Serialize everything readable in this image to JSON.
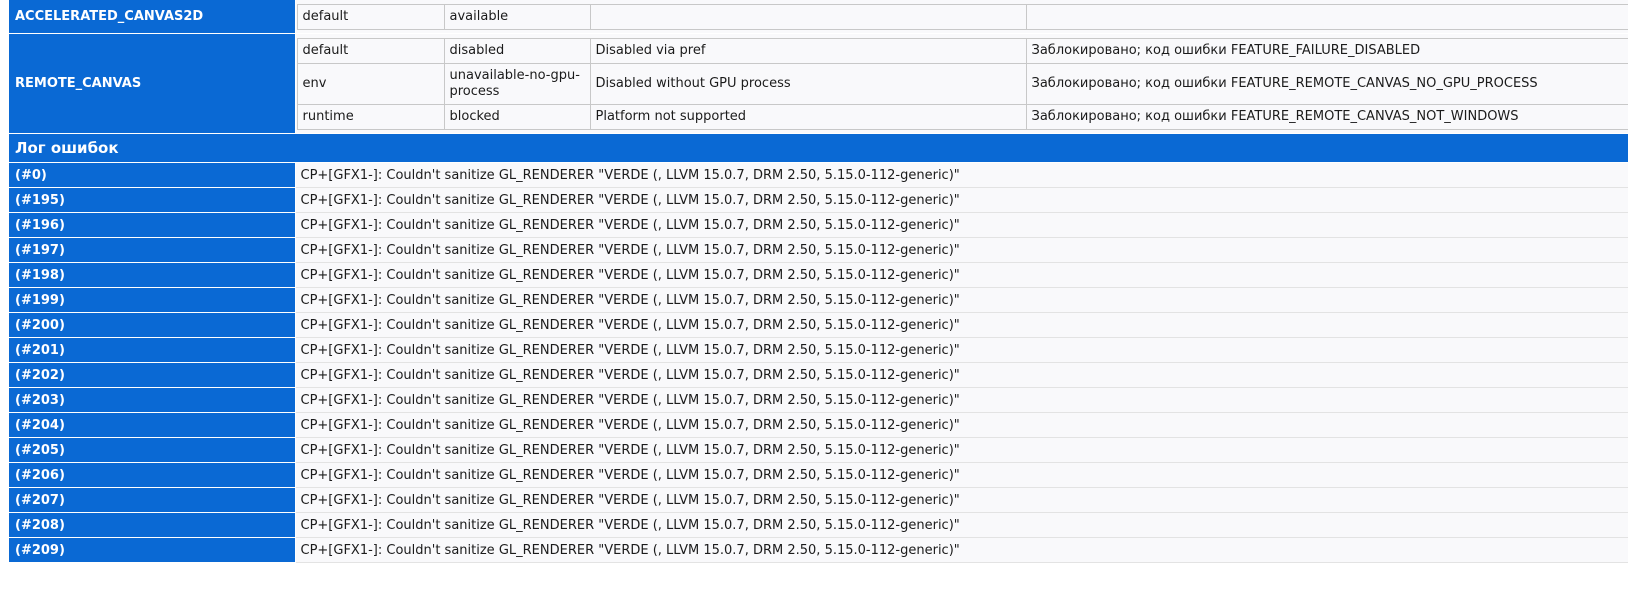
{
  "features": [
    {
      "name": "ACCELERATED_CANVAS2D",
      "rows": [
        {
          "type": "default",
          "status": "available",
          "message": "",
          "localized": ""
        }
      ]
    },
    {
      "name": "REMOTE_CANVAS",
      "rows": [
        {
          "type": "default",
          "status": "disabled",
          "message": "Disabled via pref",
          "localized": "Заблокировано; код ошибки FEATURE_FAILURE_DISABLED"
        },
        {
          "type": "env",
          "status": "unavailable-no-gpu-process",
          "message": "Disabled without GPU process",
          "localized": "Заблокировано; код ошибки FEATURE_REMOTE_CANVAS_NO_GPU_PROCESS"
        },
        {
          "type": "runtime",
          "status": "blocked",
          "message": "Platform not supported",
          "localized": "Заблокировано; код ошибки FEATURE_REMOTE_CANVAS_NOT_WINDOWS"
        }
      ]
    }
  ],
  "error_log": {
    "title": "Лог ошибок",
    "entries": [
      {
        "id": "(#0)",
        "message": "CP+[GFX1-]: Couldn't sanitize GL_RENDERER \"VERDE (, LLVM 15.0.7, DRM 2.50, 5.15.0-112-generic)\""
      },
      {
        "id": "(#195)",
        "message": "CP+[GFX1-]: Couldn't sanitize GL_RENDERER \"VERDE (, LLVM 15.0.7, DRM 2.50, 5.15.0-112-generic)\""
      },
      {
        "id": "(#196)",
        "message": "CP+[GFX1-]: Couldn't sanitize GL_RENDERER \"VERDE (, LLVM 15.0.7, DRM 2.50, 5.15.0-112-generic)\""
      },
      {
        "id": "(#197)",
        "message": "CP+[GFX1-]: Couldn't sanitize GL_RENDERER \"VERDE (, LLVM 15.0.7, DRM 2.50, 5.15.0-112-generic)\""
      },
      {
        "id": "(#198)",
        "message": "CP+[GFX1-]: Couldn't sanitize GL_RENDERER \"VERDE (, LLVM 15.0.7, DRM 2.50, 5.15.0-112-generic)\""
      },
      {
        "id": "(#199)",
        "message": "CP+[GFX1-]: Couldn't sanitize GL_RENDERER \"VERDE (, LLVM 15.0.7, DRM 2.50, 5.15.0-112-generic)\""
      },
      {
        "id": "(#200)",
        "message": "CP+[GFX1-]: Couldn't sanitize GL_RENDERER \"VERDE (, LLVM 15.0.7, DRM 2.50, 5.15.0-112-generic)\""
      },
      {
        "id": "(#201)",
        "message": "CP+[GFX1-]: Couldn't sanitize GL_RENDERER \"VERDE (, LLVM 15.0.7, DRM 2.50, 5.15.0-112-generic)\""
      },
      {
        "id": "(#202)",
        "message": "CP+[GFX1-]: Couldn't sanitize GL_RENDERER \"VERDE (, LLVM 15.0.7, DRM 2.50, 5.15.0-112-generic)\""
      },
      {
        "id": "(#203)",
        "message": "CP+[GFX1-]: Couldn't sanitize GL_RENDERER \"VERDE (, LLVM 15.0.7, DRM 2.50, 5.15.0-112-generic)\""
      },
      {
        "id": "(#204)",
        "message": "CP+[GFX1-]: Couldn't sanitize GL_RENDERER \"VERDE (, LLVM 15.0.7, DRM 2.50, 5.15.0-112-generic)\""
      },
      {
        "id": "(#205)",
        "message": "CP+[GFX1-]: Couldn't sanitize GL_RENDERER \"VERDE (, LLVM 15.0.7, DRM 2.50, 5.15.0-112-generic)\""
      },
      {
        "id": "(#206)",
        "message": "CP+[GFX1-]: Couldn't sanitize GL_RENDERER \"VERDE (, LLVM 15.0.7, DRM 2.50, 5.15.0-112-generic)\""
      },
      {
        "id": "(#207)",
        "message": "CP+[GFX1-]: Couldn't sanitize GL_RENDERER \"VERDE (, LLVM 15.0.7, DRM 2.50, 5.15.0-112-generic)\""
      },
      {
        "id": "(#208)",
        "message": "CP+[GFX1-]: Couldn't sanitize GL_RENDERER \"VERDE (, LLVM 15.0.7, DRM 2.50, 5.15.0-112-generic)\""
      },
      {
        "id": "(#209)",
        "message": "CP+[GFX1-]: Couldn't sanitize GL_RENDERER \"VERDE (, LLVM 15.0.7, DRM 2.50, 5.15.0-112-generic)\""
      }
    ]
  },
  "colors": {
    "header_blue": "#0a69d4",
    "cell_background": "#f9f9fb",
    "text": "#1b1b1b"
  }
}
